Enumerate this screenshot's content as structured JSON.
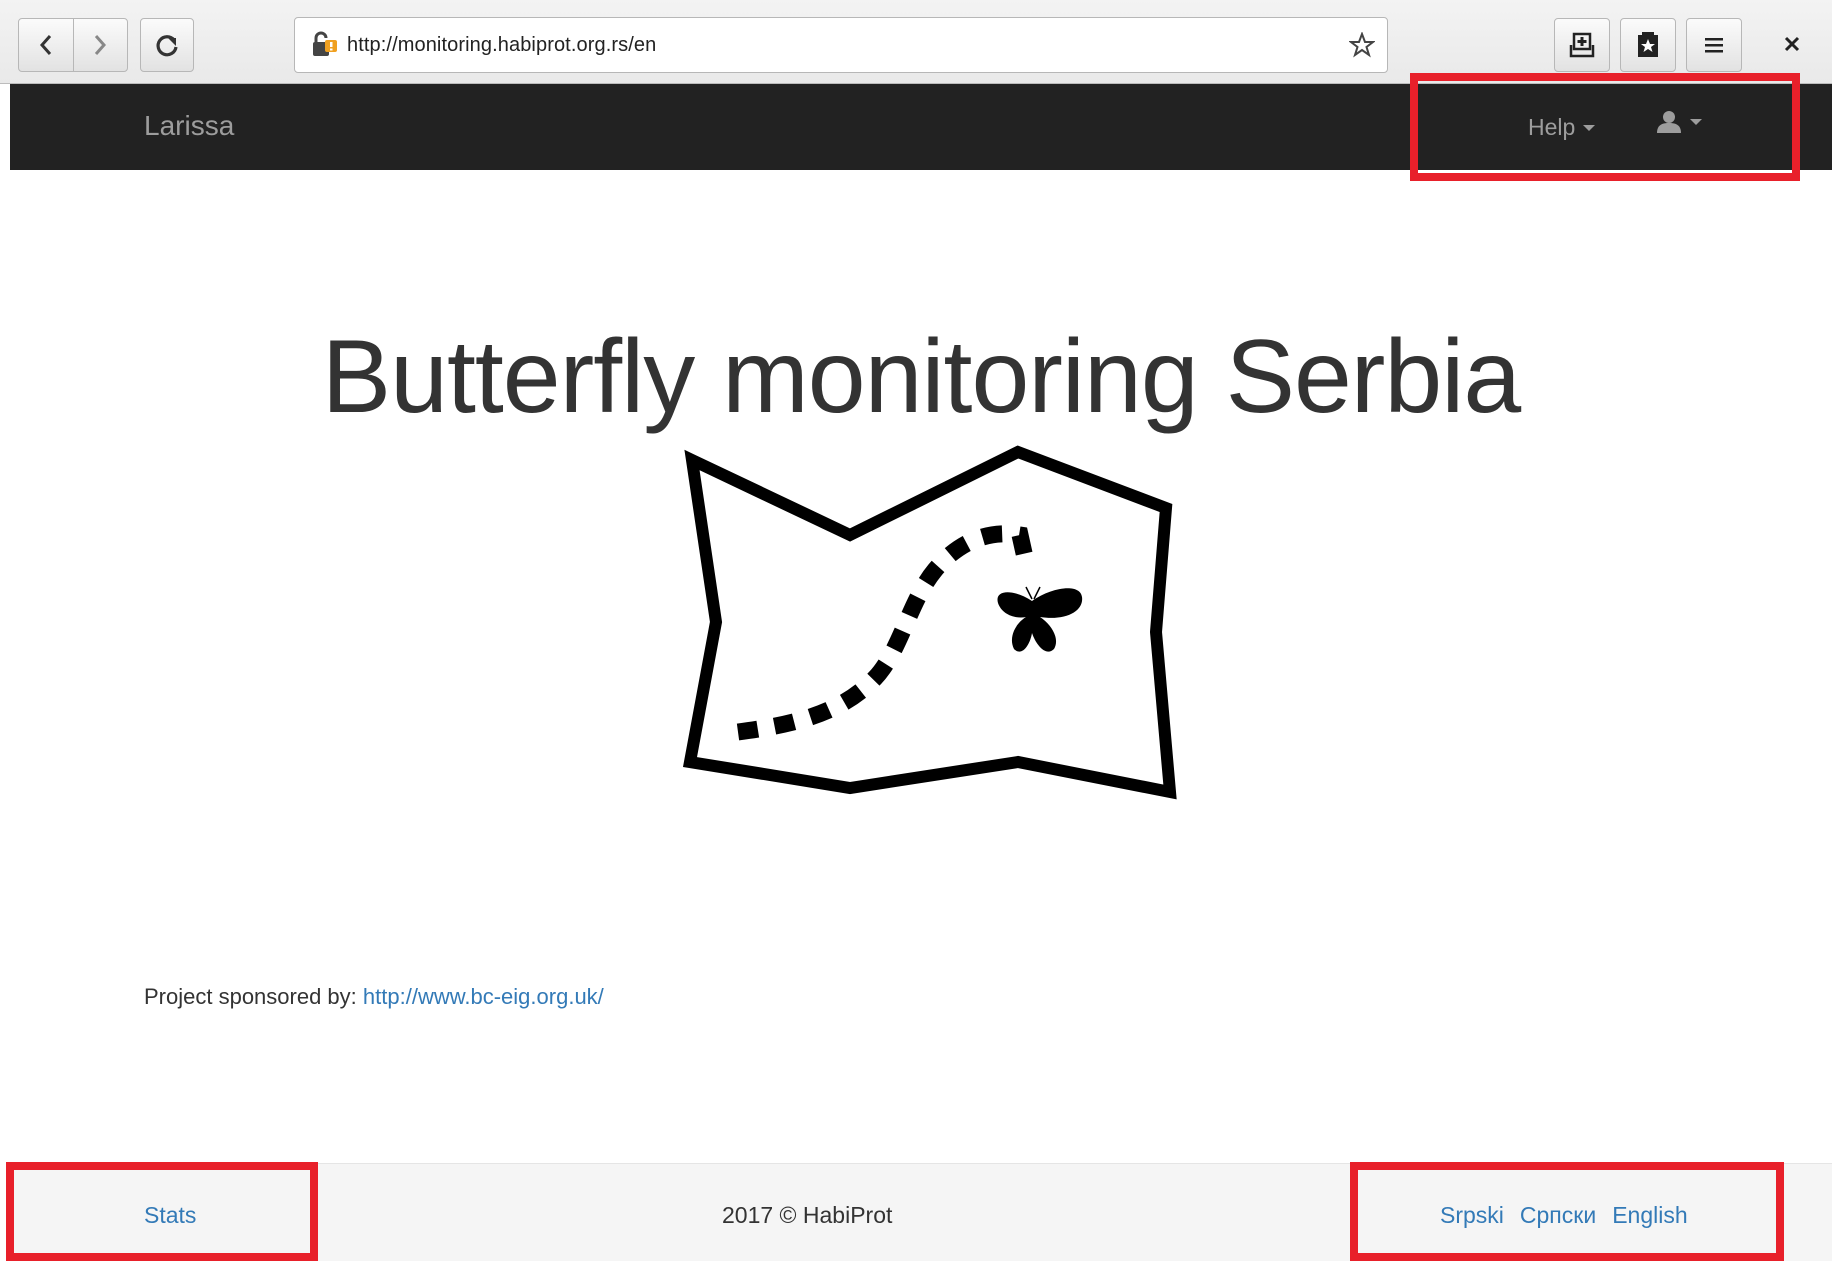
{
  "browser": {
    "url": "http://monitoring.habiprot.org.rs/en"
  },
  "navbar": {
    "brand": "Larissa",
    "help_label": "Help"
  },
  "main": {
    "headline": "Butterfly monitoring Serbia",
    "sponsor_label": "Project sponsored by:",
    "sponsor_link": "http://www.bc-eig.org.uk/"
  },
  "footer": {
    "stats_link": "Stats",
    "copyright": "2017 © HabiProt",
    "languages": [
      "Srpski",
      "Српски",
      "English"
    ]
  },
  "colors": {
    "navbar_bg": "#222222",
    "link": "#337ab7",
    "highlight": "#e8202a"
  }
}
